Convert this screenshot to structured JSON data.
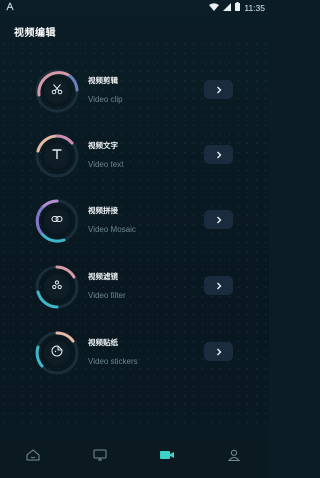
{
  "status_bar": {
    "time": "11:35"
  },
  "header": {
    "title": "视频编辑"
  },
  "items": [
    {
      "title": "视频剪辑",
      "subtitle": "Video clip",
      "icon": "scissors-icon"
    },
    {
      "title": "视频文字",
      "subtitle": "Video text",
      "icon": "text-t-icon"
    },
    {
      "title": "视频拼接",
      "subtitle": "Video Mosaic",
      "icon": "link-icon"
    },
    {
      "title": "视频滤镜",
      "subtitle": "Video filter",
      "icon": "filter-icon"
    },
    {
      "title": "视频贴纸",
      "subtitle": "Video stickers",
      "icon": "sticker-icon"
    }
  ],
  "bottom_nav": {
    "items": [
      {
        "icon": "home-icon",
        "active": false
      },
      {
        "icon": "monitor-icon",
        "active": false
      },
      {
        "icon": "video-camera-icon",
        "active": true
      },
      {
        "icon": "person-icon",
        "active": false
      }
    ]
  },
  "colors": {
    "background": "#0b1c24",
    "accent": "#3fd0c9",
    "button": "#1b2b3e",
    "subtitle": "#6d8590"
  }
}
